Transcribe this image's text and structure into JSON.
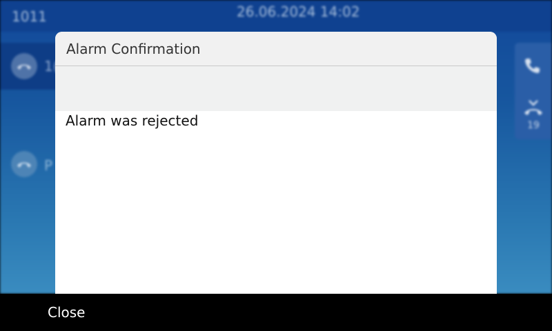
{
  "status_bar": {
    "extension": "1011",
    "datetime": "26.06.2024 14:02"
  },
  "lines": [
    {
      "label": "1(",
      "icon": "handset-hangup-icon"
    },
    {
      "label": "P",
      "icon": "handset-hangup-icon"
    }
  ],
  "right_panel": {
    "phone_icon": "phone-icon",
    "missed_calls_icon": "missed-calls-icon",
    "missed_calls_count": "19"
  },
  "dialog": {
    "title": "Alarm Confirmation",
    "message": "Alarm was rejected"
  },
  "softkeys": {
    "close_label": "Close"
  },
  "colors": {
    "background_blue": "#17579f",
    "status_bar": "#0f4190",
    "dialog_header": "#f1f1f1",
    "softkey_bar": "#000000"
  }
}
